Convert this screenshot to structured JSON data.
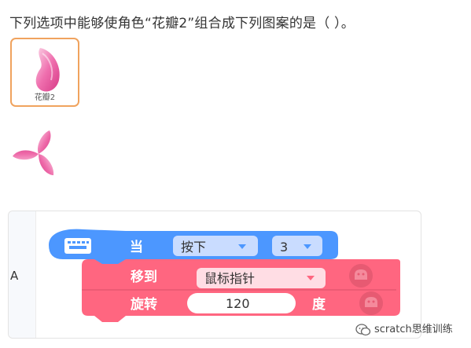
{
  "question": {
    "text": "下列选项中能够使角色“花瓣2”组合成下列图案的是（ ）。"
  },
  "sprite": {
    "name": "花瓣2"
  },
  "option": {
    "letter": "A",
    "hat_block": {
      "label": "当",
      "dropdown1": "按下",
      "dropdown2": "3"
    },
    "move_block": {
      "label": "移到",
      "dropdown": "鼠标指针"
    },
    "turn_block": {
      "label": "旋转",
      "value": "120",
      "unit": "度"
    }
  },
  "watermark": {
    "text": "scratch思维训练"
  },
  "colors": {
    "event_block": "#4c97ff",
    "motion_block": "#ff6680",
    "petal_pink": "#e8569b",
    "card_border": "#f0a35e"
  },
  "icons": [
    "keyboard-icon",
    "sprite-eye-icon",
    "wechat-icon",
    "dropdown-arrow-icon"
  ]
}
